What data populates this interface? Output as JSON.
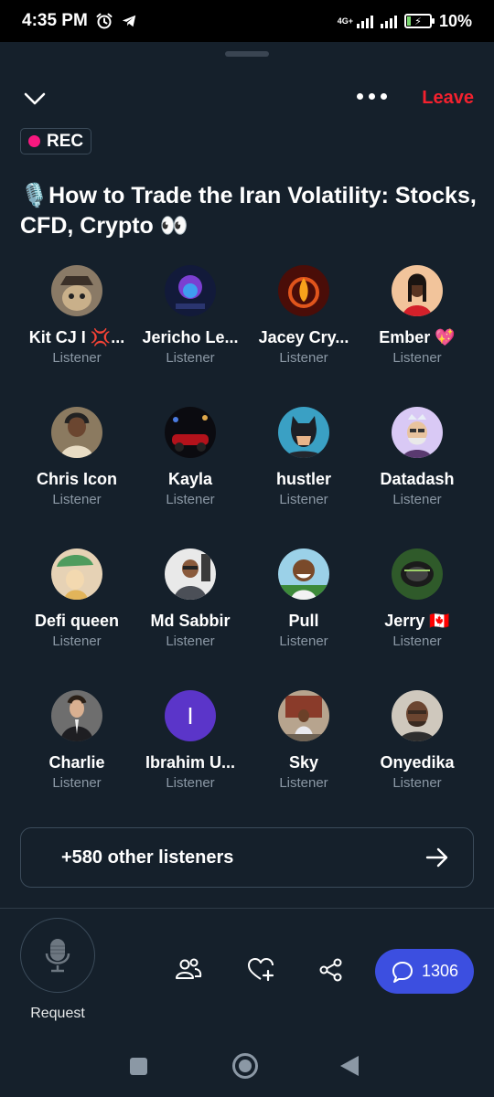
{
  "status_bar": {
    "time": "4:35 PM",
    "network": "4G+",
    "battery": "10%"
  },
  "header": {
    "leave_label": "Leave"
  },
  "space": {
    "rec_label": "REC",
    "title": "🎙️How to Trade the Iran Volatility: Stocks, CFD, Crypto 👀"
  },
  "listeners": [
    {
      "name": "Kit CJ I 💢...",
      "role": "Listener"
    },
    {
      "name": "Jericho Le...",
      "role": "Listener"
    },
    {
      "name": "Jacey Cry...",
      "role": "Listener"
    },
    {
      "name": "Ember 💖",
      "role": "Listener"
    },
    {
      "name": "Chris Icon",
      "role": "Listener"
    },
    {
      "name": "Kayla",
      "role": "Listener"
    },
    {
      "name": "hustler",
      "role": "Listener"
    },
    {
      "name": "Datadash",
      "role": "Listener"
    },
    {
      "name": "Defi queen",
      "role": "Listener"
    },
    {
      "name": "Md Sabbir",
      "role": "Listener"
    },
    {
      "name": "Pull",
      "role": "Listener"
    },
    {
      "name": "Jerry 🇨🇦",
      "role": "Listener"
    },
    {
      "name": "Charlie",
      "role": "Listener"
    },
    {
      "name": "Ibrahim U...",
      "role": "Listener",
      "initial": "I"
    },
    {
      "name": "Sky",
      "role": "Listener"
    },
    {
      "name": "Onyedika",
      "role": "Listener"
    }
  ],
  "others": {
    "label": "+580 other listeners"
  },
  "bottom": {
    "request_label": "Request",
    "comment_count": "1306"
  },
  "colors": {
    "background": "#15202b",
    "leave": "#f4212e",
    "rec_dot": "#f91880",
    "comment_button": "#3c4fe0",
    "muted_text": "#8b98a5"
  },
  "icons": [
    "alarm-icon",
    "telegram-icon",
    "chevron-down-icon",
    "more-icon",
    "microphone-icon",
    "people-icon",
    "heart-plus-icon",
    "share-icon",
    "comment-icon",
    "arrow-right-icon"
  ]
}
